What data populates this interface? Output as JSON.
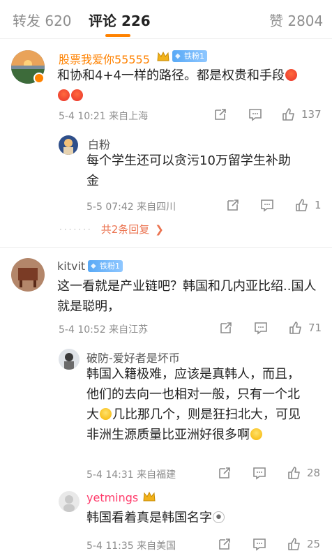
{
  "tabs": [
    {
      "label": "转发 620"
    },
    {
      "label": "评论 226"
    },
    {
      "label": "赞 2804"
    }
  ],
  "comments": [
    {
      "user": "股票我爱你55555",
      "badge": "铁粉1",
      "text_before": "和协和4+4一样的路径。都是权贵和手段",
      "meta": "5-4 10:21  来自上海",
      "likes": "137",
      "reply": {
        "user": "白粉",
        "text": "每个学生还可以贪污10万留学生补助金",
        "meta": "5-5 07:42  来自四川",
        "likes": "1"
      },
      "more_replies": "共2条回复"
    },
    {
      "user": "kitvit",
      "badge": "铁粉1",
      "text": "这一看就是产业链吧？韩国和几内亚比绍..国人就是聪明，",
      "meta": "5-4 10:52  来自江苏",
      "likes": "71",
      "replies": [
        {
          "user": "破防-爱好者是坏币",
          "text_a": "韩国入籍极难，应该是真韩人，而且，他们的去向一也相对一般，只有一个北大",
          "text_b": "几比那几个，则是狂扫北大，可见非洲生源质量比亚洲好很多啊",
          "meta": "5-4 14:31  来自福建",
          "likes": "28"
        },
        {
          "user": "yetmings",
          "text": "韩国看着真是韩国名字",
          "meta": "5-4 11:35  来自美国",
          "likes": "25"
        }
      ]
    }
  ],
  "icons": {
    "share": "share-icon",
    "comment": "comment-icon",
    "like": "thumb-up-icon",
    "verified": "verified-icon",
    "crown": "crown-icon"
  },
  "colors": {
    "accent": "#ff8200",
    "link": "#eb7350",
    "badge": "#58a9f6",
    "meta": "#8c8c8c"
  }
}
